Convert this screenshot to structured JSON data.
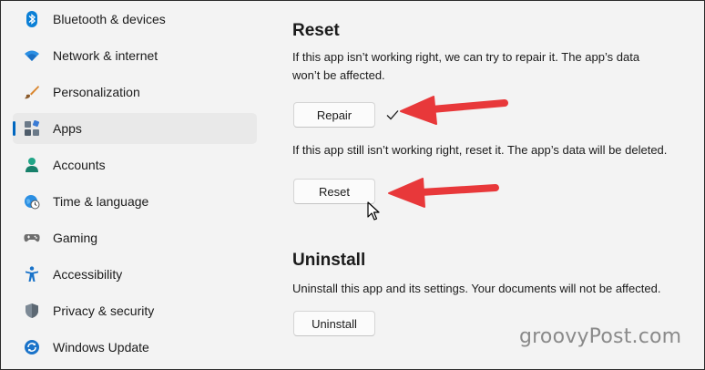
{
  "sidebar": {
    "items": [
      {
        "label": "Bluetooth & devices",
        "icon": "bluetooth-icon"
      },
      {
        "label": "Network & internet",
        "icon": "wifi-icon"
      },
      {
        "label": "Personalization",
        "icon": "brush-icon"
      },
      {
        "label": "Apps",
        "icon": "apps-icon",
        "selected": true
      },
      {
        "label": "Accounts",
        "icon": "person-icon"
      },
      {
        "label": "Time & language",
        "icon": "globe-clock-icon"
      },
      {
        "label": "Gaming",
        "icon": "gamepad-icon"
      },
      {
        "label": "Accessibility",
        "icon": "accessibility-icon"
      },
      {
        "label": "Privacy & security",
        "icon": "shield-icon"
      },
      {
        "label": "Windows Update",
        "icon": "update-icon"
      }
    ]
  },
  "reset_section": {
    "title": "Reset",
    "repair_desc_line1": "If this app isn’t working right, we can try to repair it. The app’s data",
    "repair_desc_line2": "won’t be affected.",
    "repair_button": "Repair",
    "reset_desc": "If this app still isn’t working right, reset it. The app’s data will be deleted.",
    "reset_button": "Reset"
  },
  "uninstall_section": {
    "title": "Uninstall",
    "desc": "Uninstall this app and its settings. Your documents will not be affected.",
    "button": "Uninstall"
  },
  "watermark": "groovyPost.com",
  "colors": {
    "accent": "#0067c0",
    "annotation_arrow": "#e8383a"
  }
}
